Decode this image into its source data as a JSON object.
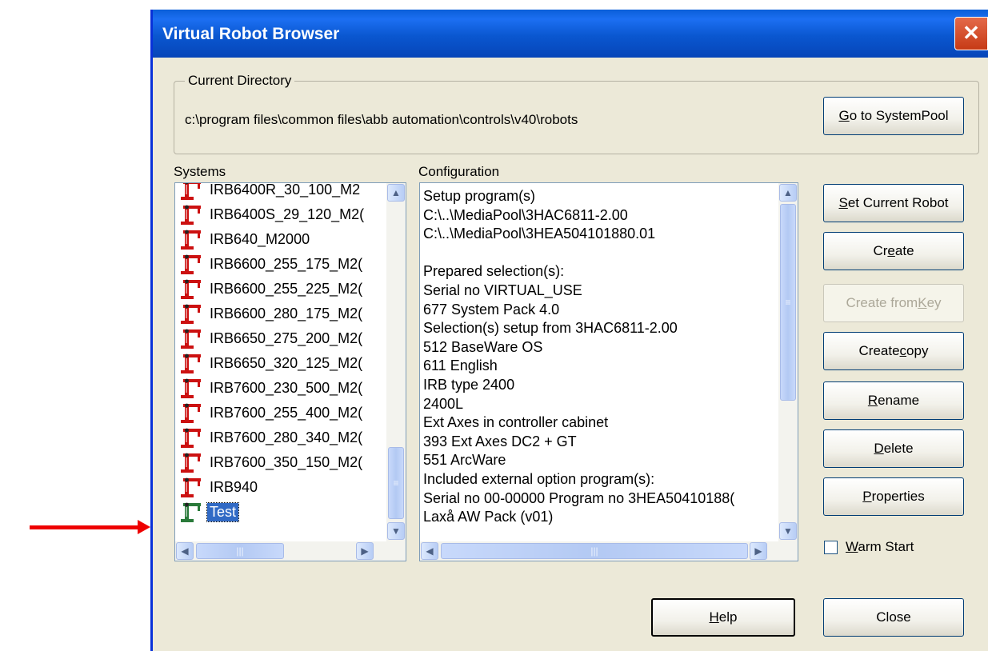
{
  "window": {
    "title": "Virtual Robot Browser",
    "close_glyph": "✕"
  },
  "current_directory": {
    "label": "Current Directory",
    "path": "c:\\program files\\common files\\abb automation\\controls\\v40\\robots",
    "goto_button": {
      "pre": "",
      "mn": "G",
      "post": "o to SystemPool"
    }
  },
  "systems": {
    "label": "Systems",
    "items": [
      {
        "label": "IRB6400R_30_100_M2",
        "selected": false,
        "icon": "robot-icon-red"
      },
      {
        "label": "IRB6400S_29_120_M2(",
        "selected": false,
        "icon": "robot-icon-red"
      },
      {
        "label": "IRB640_M2000",
        "selected": false,
        "icon": "robot-icon-red"
      },
      {
        "label": "IRB6600_255_175_M2(",
        "selected": false,
        "icon": "robot-icon-red"
      },
      {
        "label": "IRB6600_255_225_M2(",
        "selected": false,
        "icon": "robot-icon-red"
      },
      {
        "label": "IRB6600_280_175_M2(",
        "selected": false,
        "icon": "robot-icon-red"
      },
      {
        "label": "IRB6650_275_200_M2(",
        "selected": false,
        "icon": "robot-icon-red"
      },
      {
        "label": "IRB6650_320_125_M2(",
        "selected": false,
        "icon": "robot-icon-red"
      },
      {
        "label": "IRB7600_230_500_M2(",
        "selected": false,
        "icon": "robot-icon-red"
      },
      {
        "label": "IRB7600_255_400_M2(",
        "selected": false,
        "icon": "robot-icon-red"
      },
      {
        "label": "IRB7600_280_340_M2(",
        "selected": false,
        "icon": "robot-icon-red"
      },
      {
        "label": "IRB7600_350_150_M2(",
        "selected": false,
        "icon": "robot-icon-red"
      },
      {
        "label": "IRB940",
        "selected": false,
        "icon": "robot-icon-red"
      },
      {
        "label": "Test",
        "selected": true,
        "icon": "robot-icon-green"
      }
    ]
  },
  "configuration": {
    "label": "Configuration",
    "lines": [
      "Setup program(s)",
      "C:\\..\\MediaPool\\3HAC6811-2.00",
      "C:\\..\\MediaPool\\3HEA504101880.01",
      "",
      "Prepared selection(s):",
      "Serial no VIRTUAL_USE",
      "677 System Pack 4.0",
      "Selection(s) setup from 3HAC6811-2.00",
      "512 BaseWare OS",
      "611 English",
      "IRB type 2400",
      "2400L",
      "Ext Axes in controller cabinet",
      "393 Ext Axes DC2 + GT",
      "551 ArcWare",
      "Included external option program(s):",
      "Serial no 00-00000  Program no 3HEA50410188(",
      "Laxå AW Pack (v01)"
    ]
  },
  "buttons": {
    "set_current_robot": {
      "pre": "",
      "mn": "S",
      "post": "et Current Robot"
    },
    "create": {
      "pre": "Cr",
      "mn": "e",
      "post": "ate"
    },
    "create_from_key": {
      "pre": "Create from ",
      "mn": "K",
      "post": "ey"
    },
    "create_copy": {
      "pre": "Create ",
      "mn": "c",
      "post": "opy"
    },
    "rename": {
      "pre": "",
      "mn": "R",
      "post": "ename"
    },
    "delete": {
      "pre": "",
      "mn": "D",
      "post": "elete"
    },
    "properties": {
      "pre": "",
      "mn": "P",
      "post": "roperties"
    },
    "help": {
      "pre": "",
      "mn": "H",
      "post": "elp"
    },
    "close": {
      "pre": "Close",
      "mn": "",
      "post": ""
    }
  },
  "warm_start": {
    "pre": "",
    "mn": "W",
    "post": "arm Start",
    "checked": false
  },
  "scroll_glyphs": {
    "up": "▲",
    "down": "▼",
    "left": "◀",
    "right": "▶",
    "grip_v": "≡",
    "grip_h": "|||"
  },
  "colors": {
    "titlebar": "#0a5ed8",
    "selection": "#316ac5",
    "annotation_arrow": "#ee0000",
    "robot_red": "#cc1111",
    "robot_green": "#2a7a3a"
  }
}
